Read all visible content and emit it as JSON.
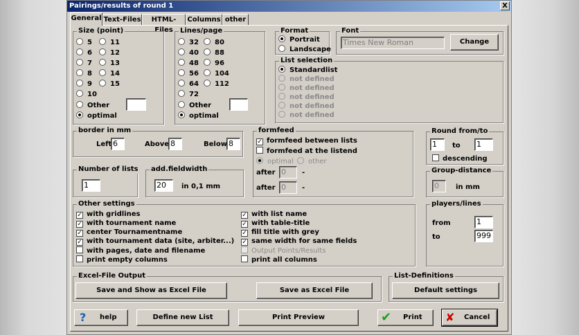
{
  "window": {
    "title": "Pairings/results of round 1",
    "close": "X"
  },
  "tabs": [
    "General",
    "Text-Files",
    "HTML-Files",
    "Columns",
    "other"
  ],
  "size": {
    "title": "Size (point)",
    "options": [
      "5",
      "6",
      "7",
      "8",
      "9",
      "10",
      "Other",
      "optimal",
      "11",
      "12",
      "13",
      "14",
      "15"
    ],
    "selected": "optimal",
    "other_value": ""
  },
  "lines": {
    "title": "Lines/page",
    "options": [
      "32",
      "40",
      "48",
      "56",
      "64",
      "72",
      "Other",
      "optimal",
      "80",
      "88",
      "96",
      "104",
      "112"
    ],
    "selected": "optimal",
    "other_value": ""
  },
  "format": {
    "title": "Format",
    "options": [
      "Portrait",
      "Landscape"
    ],
    "selected": "Portrait"
  },
  "font": {
    "title": "Font",
    "value": "Times New Roman",
    "change_label": "Change"
  },
  "list_selection": {
    "title": "List selection",
    "items": [
      "Standardlist",
      "not defined",
      "not defined",
      "not defined",
      "not defined",
      "not defined"
    ],
    "selected": "Standardlist"
  },
  "border": {
    "title": "border in mm",
    "left_label": "Left",
    "left": "6",
    "above_label": "Above",
    "above": "8",
    "below_label": "Below",
    "below": "8"
  },
  "formfeed": {
    "title": "formfeed",
    "between_lists": {
      "label": "formfeed between lists",
      "checked": true
    },
    "listend": {
      "label": "formfeed at the listend",
      "checked": false
    },
    "optimal": "optimal",
    "other": "other",
    "after1_label": "after",
    "after1": "0",
    "dash1": "-",
    "after2_label": "after",
    "after2": "0",
    "dash2": "-"
  },
  "round": {
    "title": "Round from/to",
    "from": "1",
    "to_label": "to",
    "to": "1",
    "descending": "descending"
  },
  "group_distance": {
    "title": "Group-distance",
    "value": "0",
    "unit": "in mm"
  },
  "num_lists": {
    "title": "Number of lists",
    "value": "1"
  },
  "fieldwidth": {
    "title": "add.fieldwidth",
    "value": "20",
    "unit": "in 0,1 mm"
  },
  "other_settings": {
    "title": "Other settings",
    "left": [
      {
        "label": "with gridlines",
        "checked": true
      },
      {
        "label": "with tournament name",
        "checked": true
      },
      {
        "label": "center Tournamentname",
        "checked": true
      },
      {
        "label": "with tournament data (site, arbiter...)",
        "checked": true
      },
      {
        "label": "with pages, date and filename",
        "checked": false
      },
      {
        "label": "print empty columns",
        "checked": false
      }
    ],
    "right": [
      {
        "label": "with list name",
        "checked": true
      },
      {
        "label": "with table-title",
        "checked": true
      },
      {
        "label": "fill title with grey",
        "checked": true
      },
      {
        "label": "same width for same fields",
        "checked": true
      },
      {
        "label": "Output Points/Results",
        "checked": false,
        "disabled": true
      },
      {
        "label": "print all columns",
        "checked": false
      }
    ]
  },
  "players_lines": {
    "title": "players/lines",
    "from_label": "from",
    "from": "1",
    "to_label": "to",
    "to": "999"
  },
  "excel": {
    "title": "Excel-File Output",
    "save_show": "Save and Show as Excel File",
    "save": "Save as Excel File"
  },
  "list_definitions": {
    "title": "List-Definitions",
    "default": "Default settings"
  },
  "footer": {
    "help": "help",
    "define": "Define new List",
    "preview": "Print Preview",
    "print": "Print",
    "cancel": "Cancel"
  },
  "colors": {
    "title_start": "#0a246a",
    "title_end": "#a6caf0",
    "dialog_bg": "#d4d0c8",
    "ok_green": "#1f9d1f",
    "cancel_red": "#cc0000",
    "help_blue": "#1a5fb4"
  },
  "icons": {
    "help": "question-mark-icon",
    "print": "checkmark-icon",
    "cancel": "x-icon"
  }
}
